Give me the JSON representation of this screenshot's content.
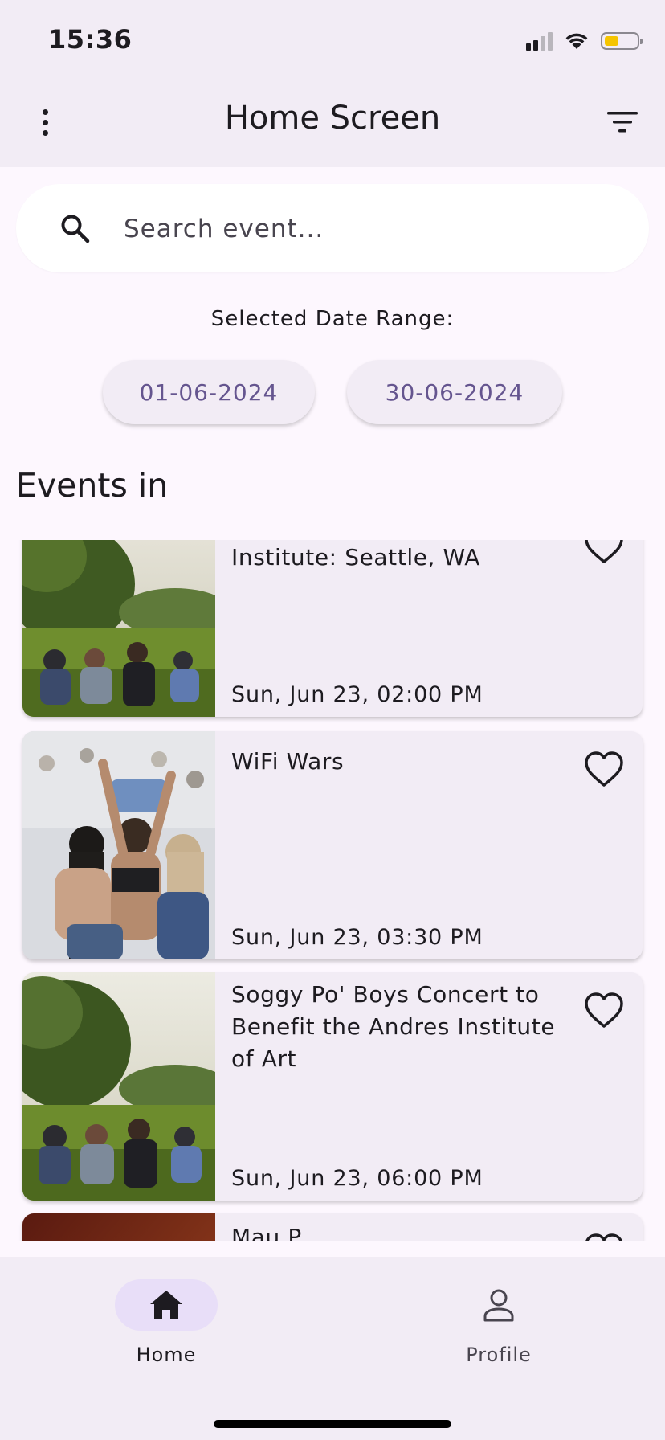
{
  "status_bar": {
    "time": "15:36"
  },
  "app_bar": {
    "title": "Home Screen",
    "menu_icon": "more-vert-icon",
    "filter_icon": "filter-list-icon"
  },
  "search": {
    "placeholder": "Search event...",
    "value": "",
    "icon": "search-icon"
  },
  "date_range": {
    "label": "Selected Date Range:",
    "start": "01-06-2024",
    "end": "30-06-2024"
  },
  "events_section": {
    "title": "Events in"
  },
  "events": [
    {
      "title": "Institute: Seattle, WA",
      "date": "Sun, Jun 23, 02:00 PM"
    },
    {
      "title": "WiFi Wars",
      "date": "Sun, Jun 23, 03:30 PM",
      "favorite_icon": "heart-outline-icon"
    },
    {
      "title": "Soggy Po' Boys Concert to Benefit the Andres Institute of Art",
      "date": "Sun, Jun 23, 06:00 PM",
      "favorite_icon": "heart-outline-icon"
    },
    {
      "title": "Mau P",
      "favorite_icon": "heart-outline-icon"
    }
  ],
  "bottom_nav": {
    "items": [
      {
        "label": "Home",
        "icon": "home-icon",
        "selected": true
      },
      {
        "label": "Profile",
        "icon": "person-outline-icon",
        "selected": false
      }
    ]
  },
  "colors": {
    "accent": "#65558f",
    "surface": "#fdf7fe",
    "container": "#f2ecf5",
    "nav_indicator": "#e8def8"
  }
}
